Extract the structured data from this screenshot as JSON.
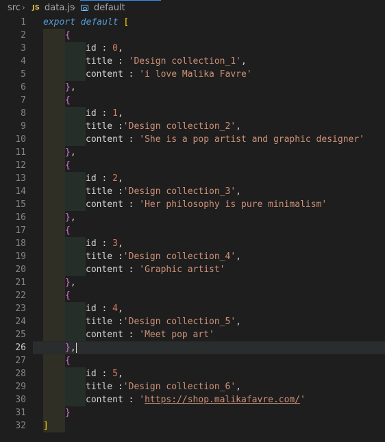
{
  "breadcrumb": {
    "src": "src",
    "js_badge": "JS",
    "file": "data.js",
    "symbol": "default"
  },
  "colors": {
    "background": "#1e1e1e",
    "keyword": "#569cd6",
    "string": "#ce9178",
    "bracket_level1": "#ffd700",
    "bracket_level2": "#da70d6",
    "line_number": "#858585"
  },
  "editor": {
    "active_line": 26,
    "line_numbers": [
      "1",
      "2",
      "3",
      "4",
      "5",
      "6",
      "7",
      "8",
      "9",
      "10",
      "11",
      "12",
      "13",
      "14",
      "15",
      "16",
      "17",
      "18",
      "19",
      "20",
      "21",
      "22",
      "23",
      "24",
      "25",
      "26",
      "27",
      "28",
      "29",
      "30",
      "31",
      "32"
    ],
    "export_keyword": "export default",
    "open_bracket": "[",
    "close_bracket": "]",
    "open_brace": "{",
    "close_brace": "}",
    "id_key": "id :",
    "title_key": "title :",
    "content_key": "content :",
    "items": [
      {
        "id": "0",
        "title": "'Design collection_1'",
        "content": "'i love Malika Favre'",
        "title_spaced": true
      },
      {
        "id": "1",
        "title": "'Design collection_2'",
        "content": "'She is a pop artist and graphic designer'",
        "title_spaced": false
      },
      {
        "id": "2",
        "title": "'Design collection_3'",
        "content": "'Her philosophy is pure minimalism'",
        "title_spaced": false
      },
      {
        "id": "3",
        "title": "'Design collection_4'",
        "content": "'Graphic artist'",
        "title_spaced": false
      },
      {
        "id": "4",
        "title": "'Design collection_5'",
        "content": "'Meet pop art'",
        "title_spaced": false
      },
      {
        "id": "5",
        "title": "'Design collection_6'",
        "content_url": "https://shop.malikafavre.com/",
        "title_spaced": false
      }
    ]
  }
}
